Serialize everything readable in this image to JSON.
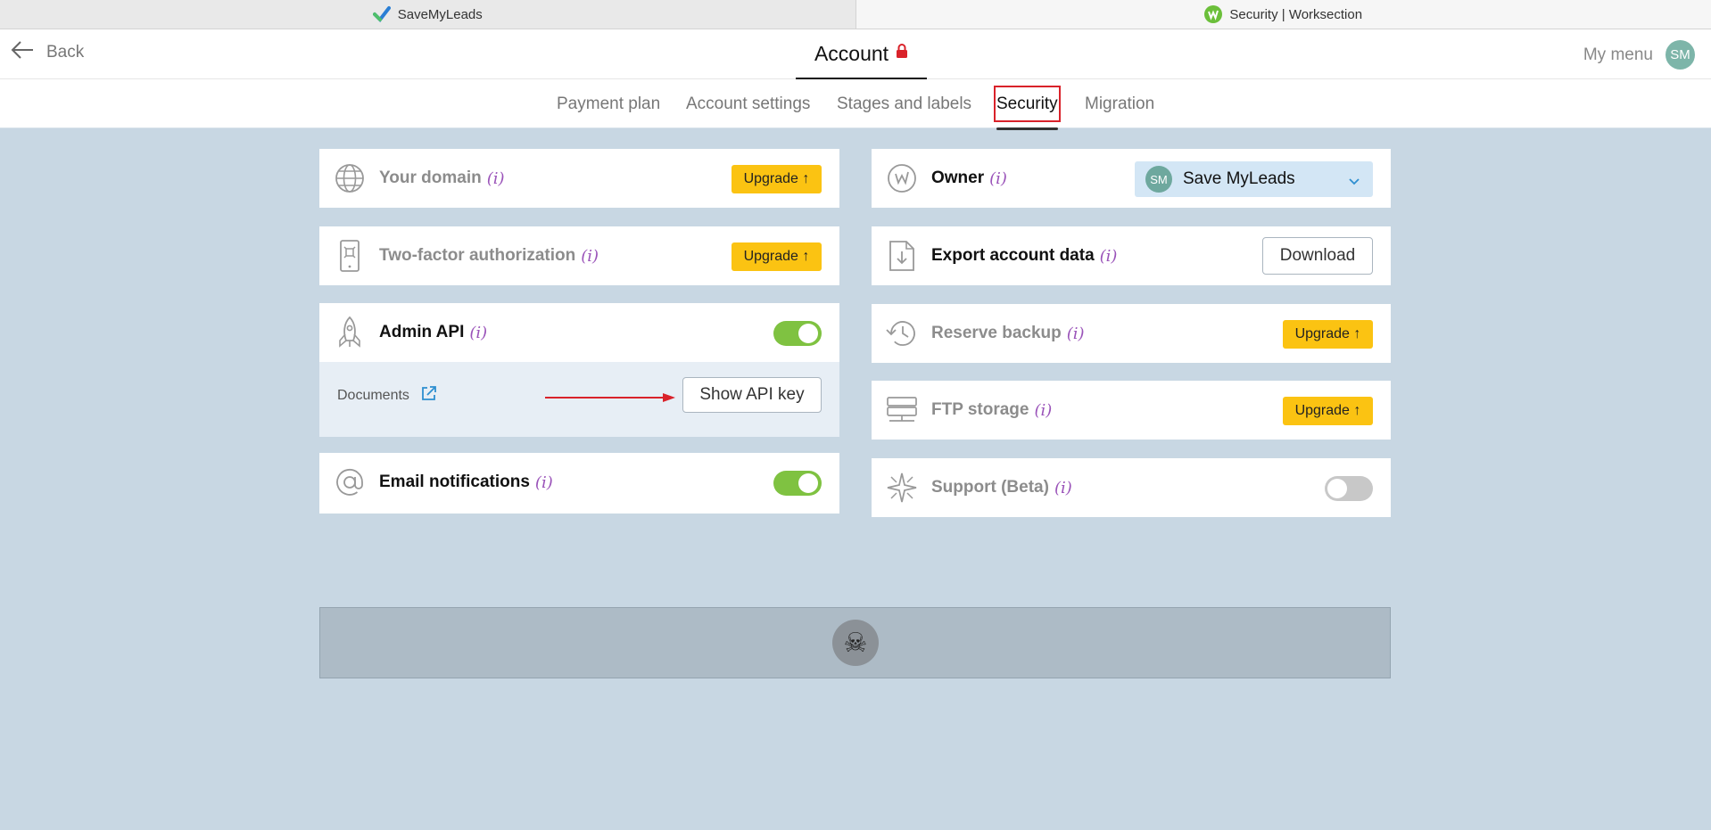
{
  "browser_tabs": [
    {
      "title": "SaveMyLeads",
      "icon": "savemyleads-check-icon"
    },
    {
      "title": "Security | Worksection",
      "icon": "worksection-icon"
    }
  ],
  "header": {
    "back_label": "Back",
    "title": "Account",
    "my_menu": "My menu",
    "user_initials": "SM"
  },
  "subnav": {
    "items": [
      "Payment plan",
      "Account settings",
      "Stages and labels",
      "Security",
      "Migration"
    ],
    "active": "Security"
  },
  "left_cards": {
    "domain": {
      "label": "Your domain",
      "info": "(i)",
      "button": "Upgrade ↑"
    },
    "two_factor": {
      "label": "Two-factor authorization",
      "info": "(i)",
      "button": "Upgrade ↑"
    },
    "admin_api": {
      "label": "Admin API",
      "info": "(i)",
      "enabled": true,
      "documents_label": "Documents",
      "show_key_button": "Show API key"
    },
    "email_notifications": {
      "label": "Email notifications",
      "info": "(i)",
      "enabled": true
    }
  },
  "right_cards": {
    "owner": {
      "label": "Owner",
      "info": "(i)",
      "selected_initials": "SM",
      "selected_name": "Save MyLeads"
    },
    "export": {
      "label": "Export account data",
      "info": "(i)",
      "button": "Download"
    },
    "reserve_backup": {
      "label": "Reserve backup",
      "info": "(i)",
      "button": "Upgrade ↑"
    },
    "ftp_storage": {
      "label": "FTP storage",
      "info": "(i)",
      "button": "Upgrade ↑"
    },
    "support": {
      "label": "Support (Beta)",
      "info": "(i)",
      "enabled": false
    }
  },
  "danger_zone": {
    "icon": "skull-crossbones-icon"
  },
  "colors": {
    "upgrade": "#fbc312",
    "toggle_on": "#7fc241",
    "info": "#9a53b9",
    "highlight_frame": "#d9222a",
    "background": "#c8d7e3"
  }
}
